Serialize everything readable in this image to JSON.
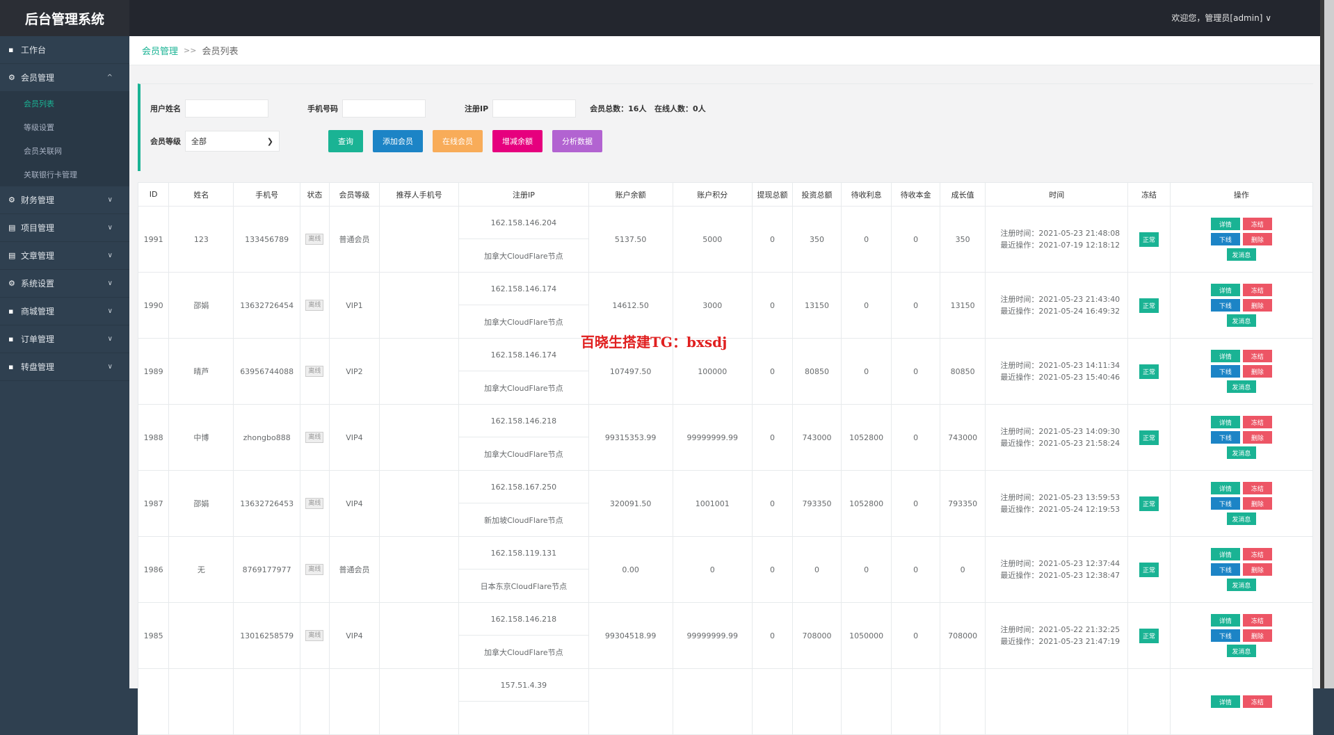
{
  "app": {
    "title": "后台管理系统",
    "welcome": "欢迎您，管理员[admin]",
    "welcome_chevron": "∨"
  },
  "sidebar": {
    "items": [
      {
        "label": "工作台",
        "icon": "grid-icon",
        "expanded": false
      },
      {
        "label": "会员管理",
        "icon": "settings-icon",
        "expanded": true,
        "children": [
          "会员列表",
          "等级设置",
          "会员关联网",
          "关联银行卡管理"
        ]
      },
      {
        "label": "财务管理",
        "icon": "settings-icon"
      },
      {
        "label": "项目管理",
        "icon": "doc-icon"
      },
      {
        "label": "文章管理",
        "icon": "doc-icon"
      },
      {
        "label": "系统设置",
        "icon": "settings-icon"
      },
      {
        "label": "商城管理",
        "icon": "grid-icon"
      },
      {
        "label": "订单管理",
        "icon": "grid-icon"
      },
      {
        "label": "转盘管理",
        "icon": "grid-icon"
      }
    ],
    "active_child": "会员列表"
  },
  "breadcrumb": {
    "parent": "会员管理",
    "sep": ">>",
    "current": "会员列表"
  },
  "filter": {
    "username_label": "用户姓名",
    "phone_label": "手机号码",
    "ip_label": "注册IP",
    "stats": "会员总数：16人   在线人数：0人",
    "level_label": "会员等级",
    "level_value": "全部",
    "buttons": [
      {
        "label": "查询",
        "color": "#1ab394"
      },
      {
        "label": "添加会员",
        "color": "#1c84c6"
      },
      {
        "label": "在线会员",
        "color": "#f8ac59"
      },
      {
        "label": "增减余额",
        "color": "#e6007e"
      },
      {
        "label": "分析数据",
        "color": "#b263d1"
      }
    ]
  },
  "table": {
    "headers": [
      "ID",
      "姓名",
      "手机号",
      "状态",
      "会员等级",
      "推荐人手机号",
      "注册IP",
      "账户余额",
      "账户积分",
      "提现总额",
      "投资总额",
      "待收利息",
      "待收本金",
      "成长值",
      "时间",
      "冻结",
      "操作"
    ],
    "status_text": "离线",
    "freeze_text": "正常",
    "ops": [
      "详情",
      "冻结",
      "下线",
      "删除",
      "发消息"
    ],
    "rows": [
      {
        "id": "1991",
        "name": "123",
        "phone": "133456789",
        "level": "普通会员",
        "ref": "",
        "ip": "162.158.146.204",
        "loc": "加拿大CloudFlare节点",
        "balance": "5137.50",
        "points": "5000",
        "withdraw": "0",
        "invest": "350",
        "interest": "0",
        "principal": "0",
        "growth": "350",
        "reg": "注册时间：2021-05-23 21:48:08",
        "last": "最近操作：2021-07-19 12:18:12"
      },
      {
        "id": "1990",
        "name": "邵娟",
        "phone": "13632726454",
        "level": "VIP1",
        "ref": "",
        "ip": "162.158.146.174",
        "loc": "加拿大CloudFlare节点",
        "balance": "14612.50",
        "points": "3000",
        "withdraw": "0",
        "invest": "13150",
        "interest": "0",
        "principal": "0",
        "growth": "13150",
        "reg": "注册时间：2021-05-23 21:43:40",
        "last": "最近操作：2021-05-24 16:49:32"
      },
      {
        "id": "1989",
        "name": "晴芦",
        "phone": "63956744088",
        "level": "VIP2",
        "ref": "",
        "ip": "162.158.146.174",
        "loc": "加拿大CloudFlare节点",
        "balance": "107497.50",
        "points": "100000",
        "withdraw": "0",
        "invest": "80850",
        "interest": "0",
        "principal": "0",
        "growth": "80850",
        "reg": "注册时间：2021-05-23 14:11:34",
        "last": "最近操作：2021-05-23 15:40:46"
      },
      {
        "id": "1988",
        "name": "中博",
        "phone": "zhongbo888",
        "level": "VIP4",
        "ref": "",
        "ip": "162.158.146.218",
        "loc": "加拿大CloudFlare节点",
        "balance": "99315353.99",
        "points": "99999999.99",
        "withdraw": "0",
        "invest": "743000",
        "interest": "1052800",
        "principal": "0",
        "growth": "743000",
        "reg": "注册时间：2021-05-23 14:09:30",
        "last": "最近操作：2021-05-23 21:58:24"
      },
      {
        "id": "1987",
        "name": "邵娟",
        "phone": "13632726453",
        "level": "VIP4",
        "ref": "",
        "ip": "162.158.167.250",
        "loc": "新加坡CloudFlare节点",
        "balance": "320091.50",
        "points": "1001001",
        "withdraw": "0",
        "invest": "793350",
        "interest": "1052800",
        "principal": "0",
        "growth": "793350",
        "reg": "注册时间：2021-05-23 13:59:53",
        "last": "最近操作：2021-05-24 12:19:53"
      },
      {
        "id": "1986",
        "name": "无",
        "phone": "8769177977",
        "level": "普通会员",
        "ref": "",
        "ip": "162.158.119.131",
        "loc": "日本东京CloudFlare节点",
        "balance": "0.00",
        "points": "0",
        "withdraw": "0",
        "invest": "0",
        "interest": "0",
        "principal": "0",
        "growth": "0",
        "reg": "注册时间：2021-05-23 12:37:44",
        "last": "最近操作：2021-05-23 12:38:47"
      },
      {
        "id": "1985",
        "name": "",
        "phone": "13016258579",
        "level": "VIP4",
        "ref": "",
        "ip": "162.158.146.218",
        "loc": "加拿大CloudFlare节点",
        "balance": "99304518.99",
        "points": "99999999.99",
        "withdraw": "0",
        "invest": "708000",
        "interest": "1050000",
        "principal": "0",
        "growth": "708000",
        "reg": "注册时间：2021-05-22 21:32:25",
        "last": "最近操作：2021-05-23 21:47:19"
      },
      {
        "id": "",
        "name": "",
        "phone": "",
        "level": "",
        "ref": "",
        "ip": "157.51.4.39",
        "loc": "",
        "balance": "",
        "points": "",
        "withdraw": "",
        "invest": "",
        "interest": "",
        "principal": "",
        "growth": "",
        "reg": "",
        "last": ""
      }
    ]
  },
  "watermark": "百晓生搭建TG：bxsdj",
  "colors": {
    "accent": "#1ab394",
    "danger": "#ed5565",
    "info": "#1c84c6",
    "sidebar": "#2f4050"
  }
}
